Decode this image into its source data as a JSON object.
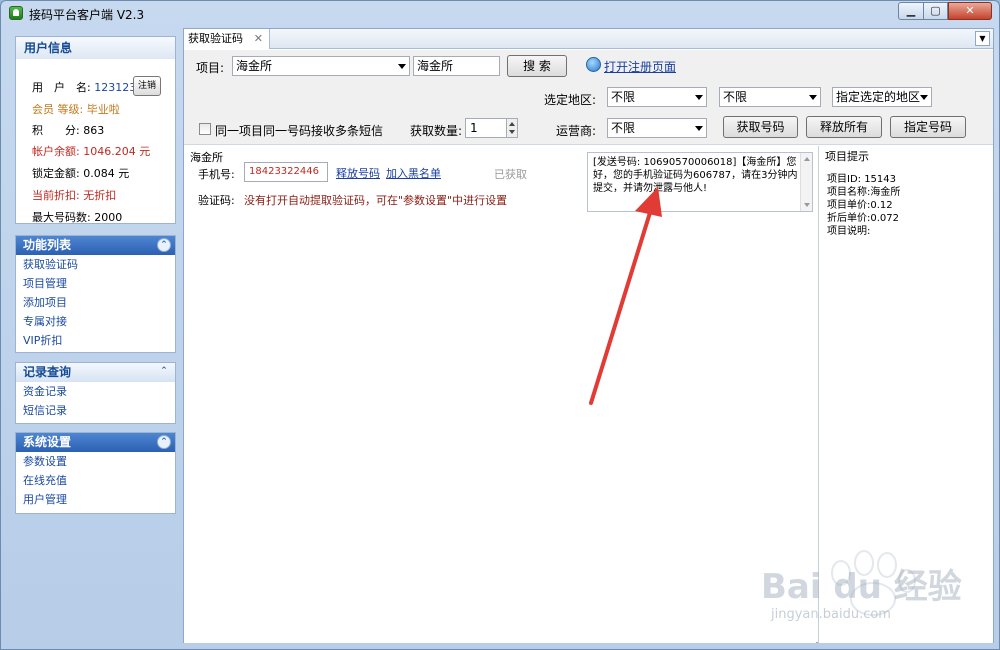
{
  "window": {
    "title": "接码平台客户端 V2.3"
  },
  "sidebar": {
    "user_info": {
      "title": "用户信息",
      "rows": [
        {
          "label": "用　户　名:",
          "value": "123123"
        },
        {
          "label": "会员 等级:",
          "value": "毕业啦"
        },
        {
          "label": "积　　分:",
          "value": "863"
        },
        {
          "label": "帐户余额:",
          "value": "1046.204 元"
        },
        {
          "label": "锁定金额:",
          "value": "0.084 元"
        },
        {
          "label": "当前折扣:",
          "value": "无折扣"
        },
        {
          "label": "最大号码数:",
          "value": "2000"
        }
      ],
      "logout_label": "注销"
    },
    "functions": {
      "title": "功能列表",
      "items": [
        "获取验证码",
        "项目管理",
        "添加项目",
        "专属对接",
        "VIP折扣"
      ]
    },
    "records": {
      "title": "记录查询",
      "items": [
        "资金记录",
        "短信记录"
      ]
    },
    "settings": {
      "title": "系统设置",
      "items": [
        "参数设置",
        "在线充值",
        "用户管理"
      ]
    }
  },
  "tabs": [
    {
      "label": "获取验证码"
    }
  ],
  "toolbar": {
    "project_label": "项目:",
    "project_value": "海金所",
    "search_value": "海金所",
    "search_button": "搜 索",
    "open_register_link": "打开注册页面",
    "region_label": "选定地区:",
    "region_1": "不限",
    "region_2": "不限",
    "region_3": "指定选定的地区",
    "multi_sms_label": "同一项目同一号码接收多条短信",
    "quantity_label": "获取数量:",
    "quantity_value": "1",
    "carrier_label": "运营商:",
    "carrier_value": "不限",
    "get_number_button": "获取号码",
    "release_all_button": "释放所有",
    "assign_number_button": "指定号码"
  },
  "work": {
    "project_name": "海金所",
    "phone_label": "手机号:",
    "phone_value": "18423322446",
    "release_link": "释放号码",
    "blacklist_link": "加入黑名单",
    "status_text": "已获取",
    "code_label": "验证码:",
    "code_message": "没有打开自动提取验证码，可在\"参数设置\"中进行设置",
    "sms_text": "[发送号码: 10690570006018]【海金所】您好，您的手机验证码为606787，请在3分钟内提交，并请勿泄露与他人!"
  },
  "project_hint": {
    "title": "项目提示",
    "lines": [
      "项目ID: 15143",
      "项目名称:海金所",
      "项目单价:0.12",
      "折后单价:0.072",
      "项目说明:"
    ]
  },
  "watermark": {
    "brand": "Bai du 经验",
    "url": "jingyan.baidu.com"
  },
  "colors": {
    "accent": "#2b60b3",
    "highlight": "#c0291f",
    "arrow": "#e03b35"
  }
}
